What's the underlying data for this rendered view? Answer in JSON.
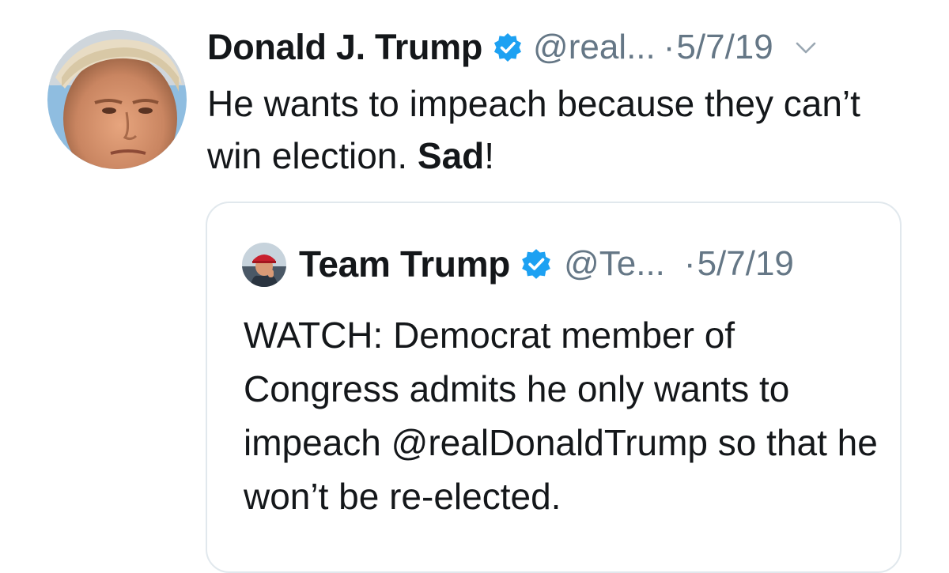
{
  "tweet": {
    "display_name": "Donald J. Trump",
    "handle": "@real...",
    "separator": "·",
    "timestamp": "5/7/19",
    "text_part1": "He wants to impeach because they can’t win election. ",
    "text_bold": "Sad",
    "text_part2": "!",
    "verified_icon": "verified-badge-icon",
    "menu_icon": "chevron-down-icon"
  },
  "quoted_tweet": {
    "display_name": "Team Trump",
    "handle": "@Te...",
    "separator": "·",
    "timestamp": "5/7/19",
    "text": "WATCH: Democrat member of Congress admits he only wants to impeach @realDonaldTrump so that he won’t be re-elected.",
    "verified_icon": "verified-badge-icon"
  },
  "colors": {
    "verified_blue": "#1da1f2",
    "secondary_text": "#657786",
    "primary_text": "#14171a",
    "card_border": "#e1e8ed"
  }
}
